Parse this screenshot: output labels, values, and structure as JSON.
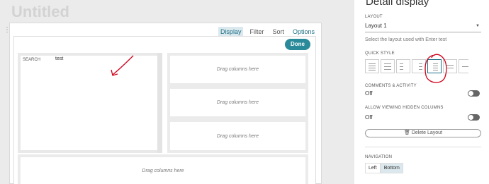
{
  "page": {
    "title": "Untitled"
  },
  "toolbar": {
    "tabs": [
      {
        "label": "Display",
        "active": true
      },
      {
        "label": "Filter"
      },
      {
        "label": "Sort"
      },
      {
        "label": "Options"
      }
    ],
    "done_label": "Done"
  },
  "layout_area": {
    "search_label": "SEARCH",
    "search_value": "test",
    "drop_text": "Drag columns here"
  },
  "panel": {
    "title": "Detail display",
    "layout": {
      "heading": "LAYOUT",
      "selected": "Layout 1",
      "hint": "Select the layout used with Enter test"
    },
    "quick_style": {
      "heading": "QUICK STYLE",
      "selected_index": 4
    },
    "comments": {
      "heading": "COMMENTS & ACTIVITY",
      "state": "Off"
    },
    "hidden_columns": {
      "heading": "ALLOW VIEWING HIDDEN COLUMNS",
      "state": "Off"
    },
    "delete_label": "Delete Layout",
    "navigation": {
      "heading": "NAVIGATION",
      "options": [
        "Left",
        "Bottom"
      ],
      "selected": "Bottom"
    }
  },
  "colors": {
    "accent": "#2a8a99",
    "annotation": "#d0021b"
  }
}
